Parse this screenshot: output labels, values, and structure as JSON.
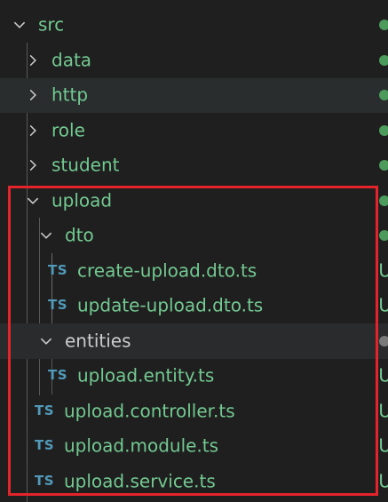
{
  "tree": {
    "rows": [
      {
        "label": "src",
        "kind": "folder",
        "expanded": true,
        "decoration": "dot"
      },
      {
        "label": "data",
        "kind": "folder",
        "expanded": false,
        "decoration": "dot"
      },
      {
        "label": "http",
        "kind": "folder",
        "expanded": false,
        "decoration": "dot"
      },
      {
        "label": "role",
        "kind": "folder",
        "expanded": false,
        "decoration": "dot"
      },
      {
        "label": "student",
        "kind": "folder",
        "expanded": false,
        "decoration": "dot"
      },
      {
        "label": "upload",
        "kind": "folder",
        "expanded": true,
        "decoration": "dot"
      },
      {
        "label": "dto",
        "kind": "folder",
        "expanded": true,
        "decoration": "dot"
      },
      {
        "label": "create-upload.dto.ts",
        "kind": "file",
        "icon_text": "TS",
        "decoration": "U"
      },
      {
        "label": "update-upload.dto.ts",
        "kind": "file",
        "icon_text": "TS",
        "decoration": "U"
      },
      {
        "label": "entities",
        "kind": "folder",
        "expanded": true,
        "decoration": "dot-gray"
      },
      {
        "label": "upload.entity.ts",
        "kind": "file",
        "icon_text": "TS",
        "decoration": "U"
      },
      {
        "label": "upload.controller.ts",
        "kind": "file",
        "icon_text": "TS",
        "decoration": "U"
      },
      {
        "label": "upload.module.ts",
        "kind": "file",
        "icon_text": "TS",
        "decoration": "U"
      },
      {
        "label": "upload.service.ts",
        "kind": "file",
        "icon_text": "TS",
        "decoration": "U"
      }
    ]
  },
  "colors": {
    "background": "#1f1f1f",
    "untracked_text": "#73c991",
    "ts_icon": "#519aba",
    "annotation_box": "#e3242b"
  },
  "icons": {
    "expanded": "chevron-down-icon",
    "collapsed": "chevron-right-icon",
    "file": "typescript-file-icon"
  }
}
